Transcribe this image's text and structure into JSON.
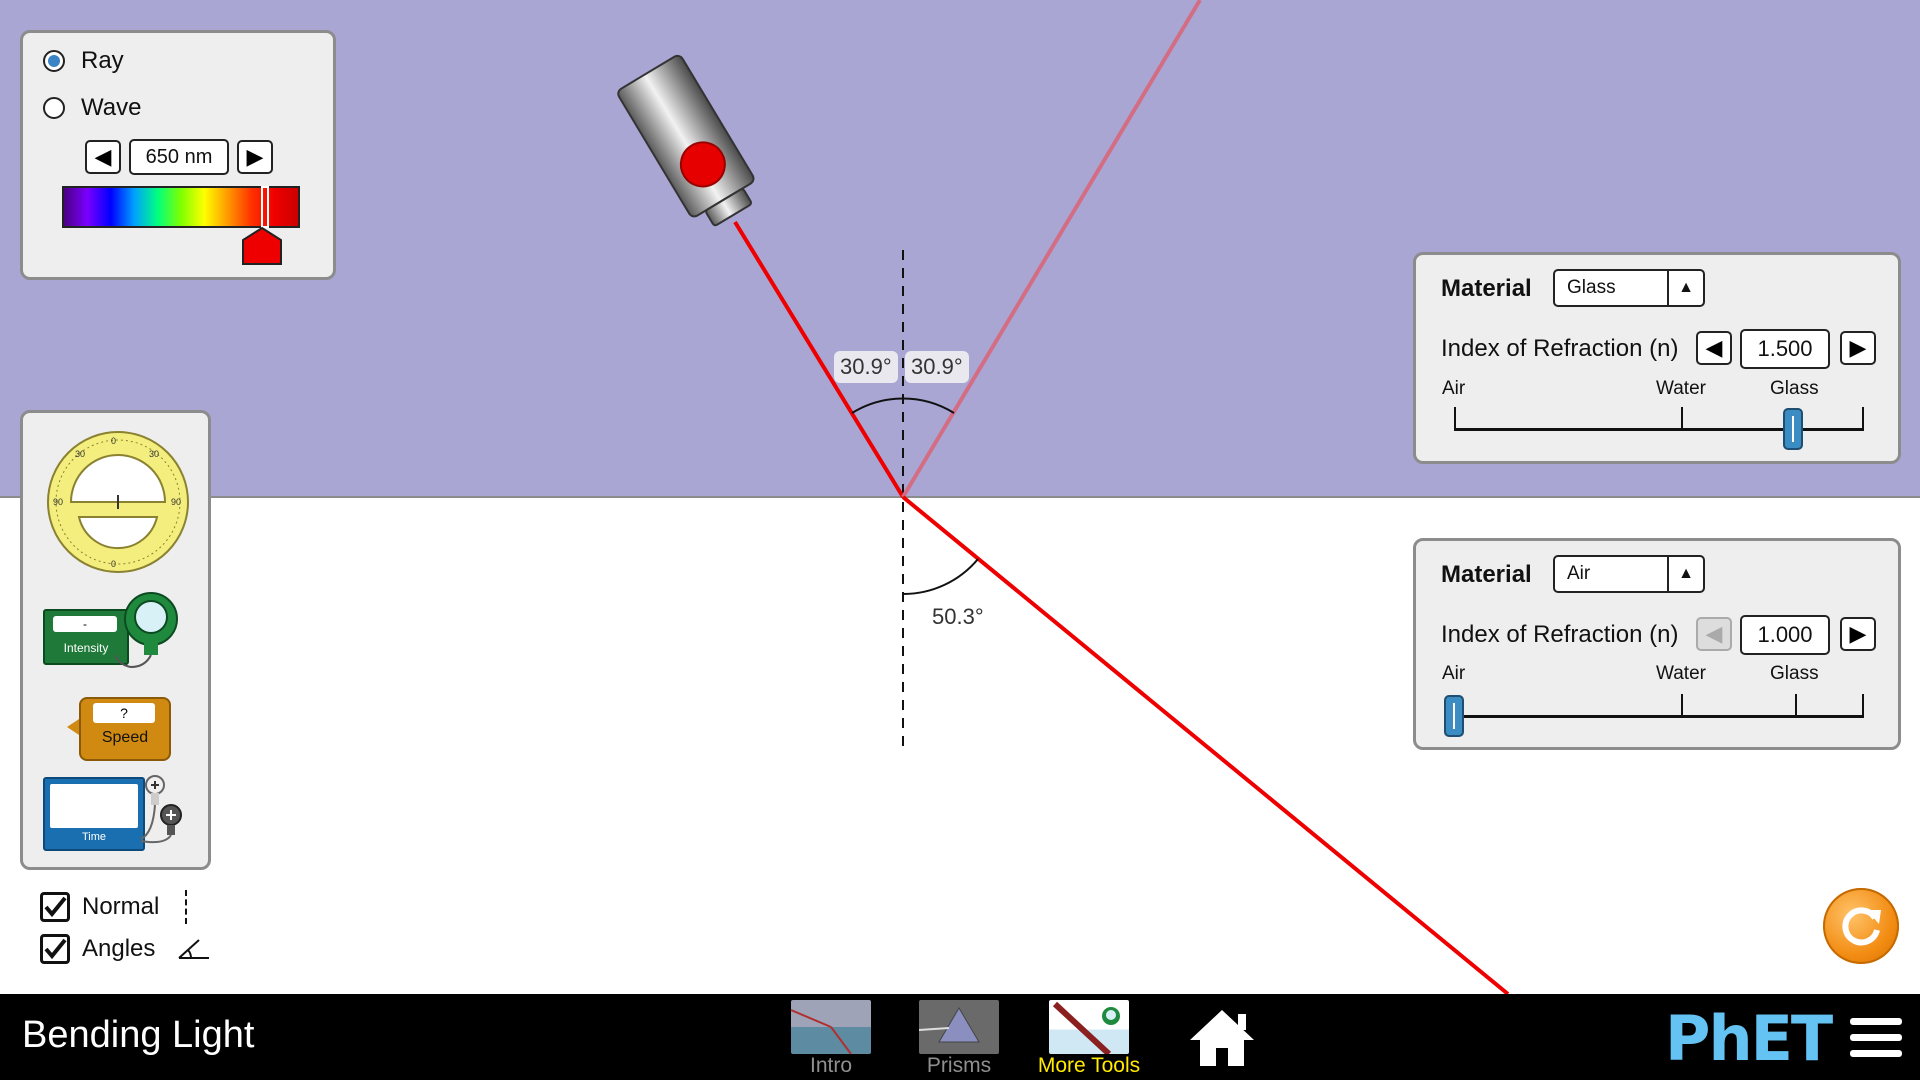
{
  "app": {
    "title": "Bending Light"
  },
  "light_source": {
    "mode_options": [
      "Ray",
      "Wave"
    ],
    "selected_mode": "Ray",
    "wavelength_display": "650 nm",
    "laser_color": "#ee0000"
  },
  "scene": {
    "top_medium_color": "#a9a6d4",
    "bottom_medium_color": "#ffffff",
    "angle_incident": "30.9°",
    "angle_reflected": "30.9°",
    "angle_refracted": "50.3°"
  },
  "tools": {
    "intensity_label": "Intensity",
    "intensity_value": "-",
    "speed_label": "Speed",
    "speed_value": "?",
    "time_label": "Time"
  },
  "checkboxes": [
    {
      "label": "Normal",
      "checked": true
    },
    {
      "label": "Angles",
      "checked": true
    }
  ],
  "top_material": {
    "title": "Material",
    "selected": "Glass",
    "index_label": "Index of Refraction (n)",
    "index_value": "1.500",
    "scale_labels": [
      "Air",
      "Water",
      "Glass"
    ],
    "slider_level_fraction": 0.84
  },
  "bottom_material": {
    "title": "Material",
    "selected": "Air",
    "index_label": "Index of Refraction (n)",
    "index_value": "1.000",
    "scale_labels": [
      "Air",
      "Water",
      "Glass"
    ],
    "slider_level_fraction": 0.0
  },
  "navbar": {
    "tabs": [
      {
        "label": "Intro",
        "active": false
      },
      {
        "label": "Prisms",
        "active": false
      },
      {
        "label": "More Tools",
        "active": true
      }
    ],
    "logo_text": "PhET"
  },
  "colors": {
    "active_tab": "#ffea00",
    "inactive_tab": "#8f8f8f",
    "phet_blue": "#64c3f2"
  }
}
